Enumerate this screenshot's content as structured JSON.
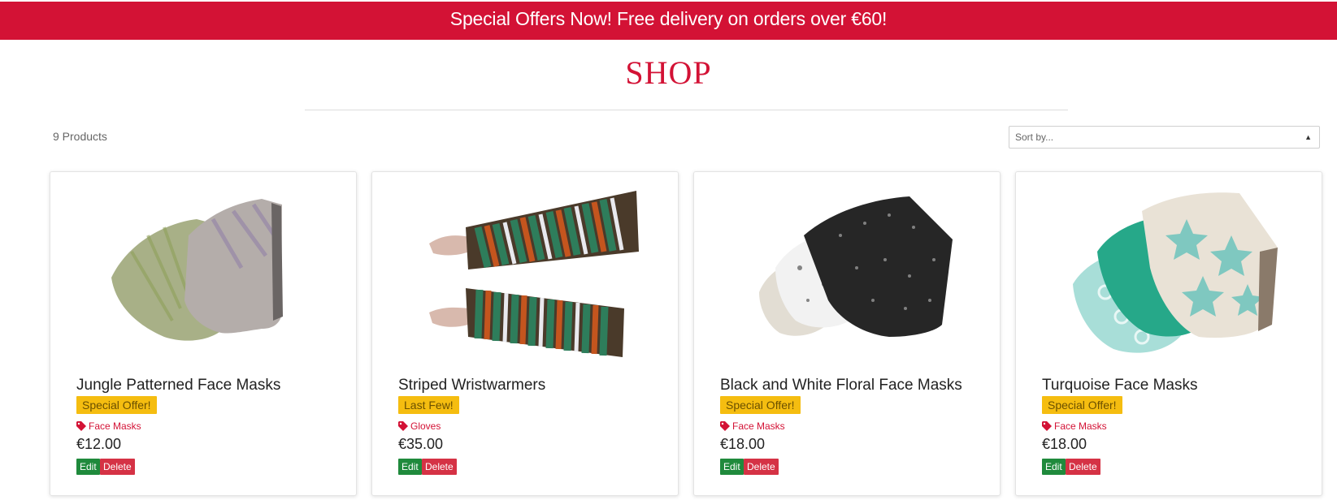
{
  "banner": {
    "text": "Special Offers Now! Free delivery on orders over €60!"
  },
  "page": {
    "title": "SHOP"
  },
  "toolbar": {
    "product_count": "9 Products",
    "sort_placeholder": "Sort by..."
  },
  "colors": {
    "brand": "#d31235",
    "badge": "#f5bd10",
    "edit": "#1f8a3c",
    "delete": "#d53245"
  },
  "products": [
    {
      "name": "Jungle Patterned Face Masks",
      "badge": "Special Offer!",
      "category": "Face Masks",
      "price": "€12.00",
      "edit_label": "Edit",
      "delete_label": "Delete",
      "image_icon": "face-mask-image"
    },
    {
      "name": "Striped Wristwarmers",
      "badge": "Last Few!",
      "category": "Gloves",
      "price": "€35.00",
      "edit_label": "Edit",
      "delete_label": "Delete",
      "image_icon": "wristwarmers-image"
    },
    {
      "name": "Black and White Floral Face Masks",
      "badge": "Special Offer!",
      "category": "Face Masks",
      "price": "€18.00",
      "edit_label": "Edit",
      "delete_label": "Delete",
      "image_icon": "face-mask-image"
    },
    {
      "name": "Turquoise Face Masks",
      "badge": "Special Offer!",
      "category": "Face Masks",
      "price": "€18.00",
      "edit_label": "Edit",
      "delete_label": "Delete",
      "image_icon": "face-mask-image"
    }
  ]
}
